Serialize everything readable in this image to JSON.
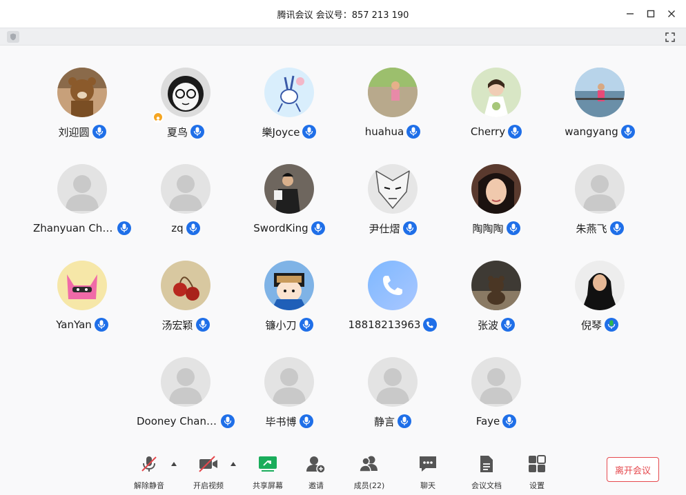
{
  "window": {
    "title": "腾讯会议 会议号：857 213 190"
  },
  "participants": [
    {
      "name": "刘迎圆",
      "avatar": "brown-bear-photo",
      "mic": "blue"
    },
    {
      "name": "夏鸟",
      "avatar": "cartoon-glasses-girl",
      "mic": "blue",
      "host": true
    },
    {
      "name": "樂Joyce",
      "avatar": "bunny-sketch",
      "mic": "blue"
    },
    {
      "name": "huahua",
      "avatar": "child-park-photo",
      "mic": "blue"
    },
    {
      "name": "Cherry",
      "avatar": "bride-photo",
      "mic": "blue"
    },
    {
      "name": "wangyang",
      "avatar": "lakeside-photo",
      "mic": "blue"
    },
    {
      "name": "Zhanyuan Cha...",
      "avatar": "default",
      "mic": "blue"
    },
    {
      "name": "zq",
      "avatar": "default",
      "mic": "blue"
    },
    {
      "name": "SwordKing",
      "avatar": "speaker-photo",
      "mic": "blue"
    },
    {
      "name": "尹仕熠",
      "avatar": "manga-face",
      "mic": "blue"
    },
    {
      "name": "陶陶陶",
      "avatar": "selfie-photo",
      "mic": "blue"
    },
    {
      "name": "朱燕飞",
      "avatar": "default",
      "mic": "blue"
    },
    {
      "name": "YanYan",
      "avatar": "pink-cat-cartoon",
      "mic": "blue"
    },
    {
      "name": "汤宏颖",
      "avatar": "cherries-photo",
      "mic": "blue"
    },
    {
      "name": "镰小刀",
      "avatar": "maruko-cartoon",
      "mic": "blue"
    },
    {
      "name": "18818213963",
      "avatar": "phone-call",
      "mic": "phone"
    },
    {
      "name": "张波",
      "avatar": "teddy-bear-photo",
      "mic": "blue"
    },
    {
      "name": "倪琴",
      "avatar": "woman-portrait",
      "mic": "green"
    },
    {
      "name": "",
      "avatar": "none",
      "mic": "none",
      "empty": true
    },
    {
      "name": "Dooney Chang▯",
      "avatar": "default",
      "mic": "blue"
    },
    {
      "name": "毕书博",
      "avatar": "default",
      "mic": "blue"
    },
    {
      "name": "静言",
      "avatar": "default",
      "mic": "blue"
    },
    {
      "name": "Faye",
      "avatar": "default",
      "mic": "blue"
    }
  ],
  "toolbar": {
    "unmute": "解除静音",
    "start_video": "开启视频",
    "share_screen": "共享屏幕",
    "invite": "邀请",
    "members": "成员(22)",
    "chat": "聊天",
    "docs": "会议文档",
    "settings": "设置",
    "leave": "离开会议"
  },
  "colors": {
    "mic_blue": "#1f6fe8",
    "mic_green": "#2db84d",
    "leave_red": "#e5484d",
    "share_green": "#1aad5b"
  }
}
